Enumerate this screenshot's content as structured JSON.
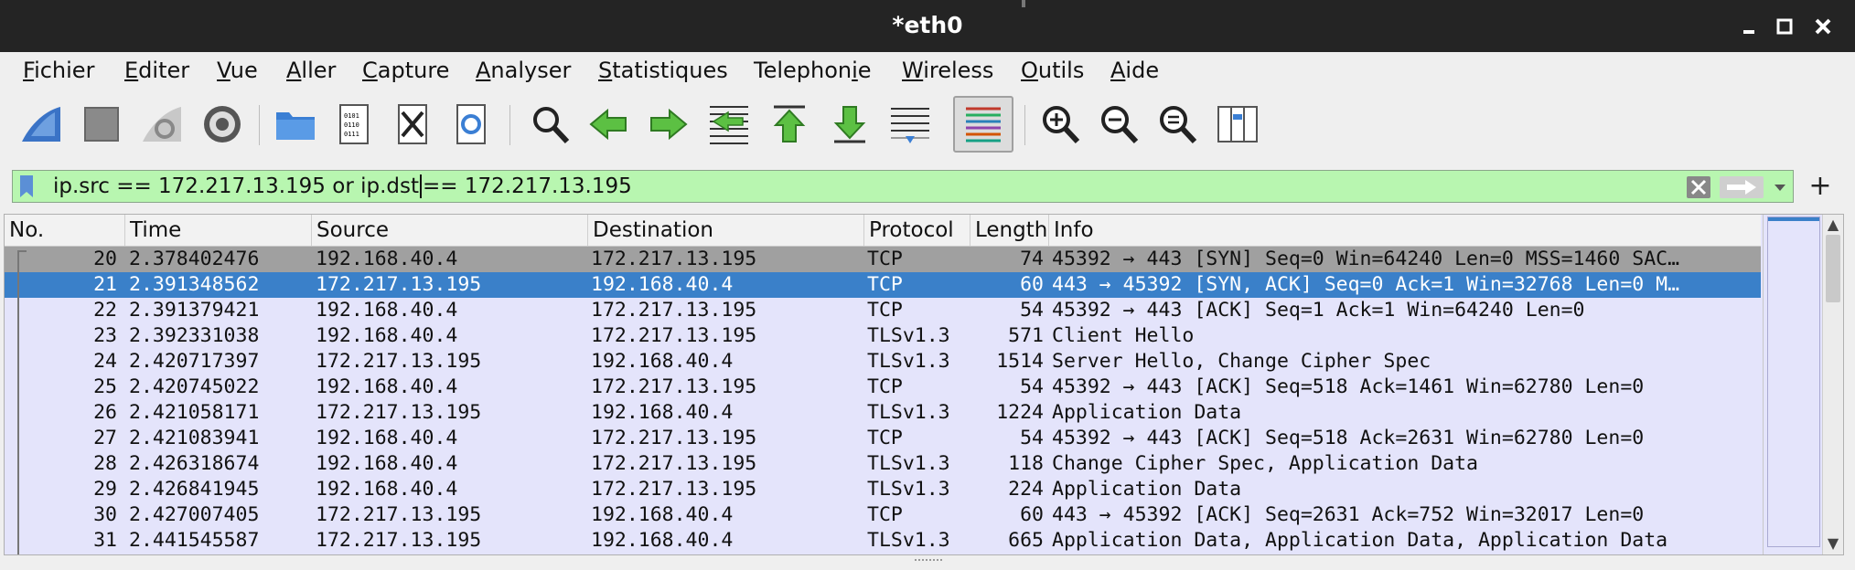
{
  "window": {
    "title": "*eth0"
  },
  "menu": {
    "items": [
      {
        "pre": "",
        "acc": "F",
        "post": "ichier"
      },
      {
        "pre": "",
        "acc": "E",
        "post": "diter"
      },
      {
        "pre": "",
        "acc": "V",
        "post": "ue"
      },
      {
        "pre": "",
        "acc": "A",
        "post": "ller"
      },
      {
        "pre": "",
        "acc": "C",
        "post": "apture"
      },
      {
        "pre": "",
        "acc": "A",
        "post": "nalyser"
      },
      {
        "pre": "",
        "acc": "S",
        "post": "tatistiques"
      },
      {
        "pre": "Telephon",
        "acc": "i",
        "post": "e"
      },
      {
        "pre": "",
        "acc": "W",
        "post": "ireless"
      },
      {
        "pre": "",
        "acc": "O",
        "post": "utils"
      },
      {
        "pre": "",
        "acc": "A",
        "post": "ide"
      }
    ]
  },
  "toolbar": {
    "icons": [
      "shark-fin-start-icon",
      "stop-square-icon",
      "restart-capture-icon",
      "capture-options-gear-icon",
      "open-folder-icon",
      "save-file-icon",
      "close-file-icon",
      "reload-file-icon",
      "find-packet-icon",
      "go-back-icon",
      "go-forward-icon",
      "go-to-packet-icon",
      "first-packet-icon",
      "last-packet-icon",
      "autoscroll-icon",
      "colorize-icon",
      "zoom-in-icon",
      "zoom-out-icon",
      "normal-size-icon",
      "resize-columns-icon"
    ]
  },
  "filter": {
    "text_before_cursor": "ip.src == 172.217.13.195 or ip.dst",
    "text_after_cursor": "== 172.217.13.195",
    "background": "#b8f6b0"
  },
  "packet_list": {
    "columns": [
      "No.",
      "Time",
      "Source",
      "Destination",
      "Protocol",
      "Length",
      "Info"
    ],
    "rows": [
      {
        "no": "20",
        "time": "2.378402476",
        "src": "192.168.40.4",
        "dst": "172.217.13.195",
        "proto": "TCP",
        "len": "74",
        "info": "45392 → 443 [SYN] Seq=0 Win=64240 Len=0 MSS=1460 SAC…"
      },
      {
        "no": "21",
        "time": "2.391348562",
        "src": "172.217.13.195",
        "dst": "192.168.40.4",
        "proto": "TCP",
        "len": "60",
        "info": "443 → 45392 [SYN, ACK] Seq=0 Ack=1 Win=32768 Len=0 M…"
      },
      {
        "no": "22",
        "time": "2.391379421",
        "src": "192.168.40.4",
        "dst": "172.217.13.195",
        "proto": "TCP",
        "len": "54",
        "info": "45392 → 443 [ACK] Seq=1 Ack=1 Win=64240 Len=0"
      },
      {
        "no": "23",
        "time": "2.392331038",
        "src": "192.168.40.4",
        "dst": "172.217.13.195",
        "proto": "TLSv1.3",
        "len": "571",
        "info": "Client Hello"
      },
      {
        "no": "24",
        "time": "2.420717397",
        "src": "172.217.13.195",
        "dst": "192.168.40.4",
        "proto": "TLSv1.3",
        "len": "1514",
        "info": "Server Hello, Change Cipher Spec"
      },
      {
        "no": "25",
        "time": "2.420745022",
        "src": "192.168.40.4",
        "dst": "172.217.13.195",
        "proto": "TCP",
        "len": "54",
        "info": "45392 → 443 [ACK] Seq=518 Ack=1461 Win=62780 Len=0"
      },
      {
        "no": "26",
        "time": "2.421058171",
        "src": "172.217.13.195",
        "dst": "192.168.40.4",
        "proto": "TLSv1.3",
        "len": "1224",
        "info": "Application Data"
      },
      {
        "no": "27",
        "time": "2.421083941",
        "src": "192.168.40.4",
        "dst": "172.217.13.195",
        "proto": "TCP",
        "len": "54",
        "info": "45392 → 443 [ACK] Seq=518 Ack=2631 Win=62780 Len=0"
      },
      {
        "no": "28",
        "time": "2.426318674",
        "src": "192.168.40.4",
        "dst": "172.217.13.195",
        "proto": "TLSv1.3",
        "len": "118",
        "info": "Change Cipher Spec, Application Data"
      },
      {
        "no": "29",
        "time": "2.426841945",
        "src": "192.168.40.4",
        "dst": "172.217.13.195",
        "proto": "TLSv1.3",
        "len": "224",
        "info": "Application Data"
      },
      {
        "no": "30",
        "time": "2.427007405",
        "src": "172.217.13.195",
        "dst": "192.168.40.4",
        "proto": "TCP",
        "len": "60",
        "info": "443 → 45392 [ACK] Seq=2631 Ack=752 Win=32017 Len=0"
      },
      {
        "no": "31",
        "time": "2.441545587",
        "src": "172.217.13.195",
        "dst": "192.168.40.4",
        "proto": "TLSv1.3",
        "len": "665",
        "info": "Application Data, Application Data, Application Data"
      }
    ],
    "selected_row": "21",
    "colors": {
      "syn_row": "#a0a0a0",
      "selected_row": "#3a80c9",
      "default_row": "#e4e4fb"
    }
  }
}
